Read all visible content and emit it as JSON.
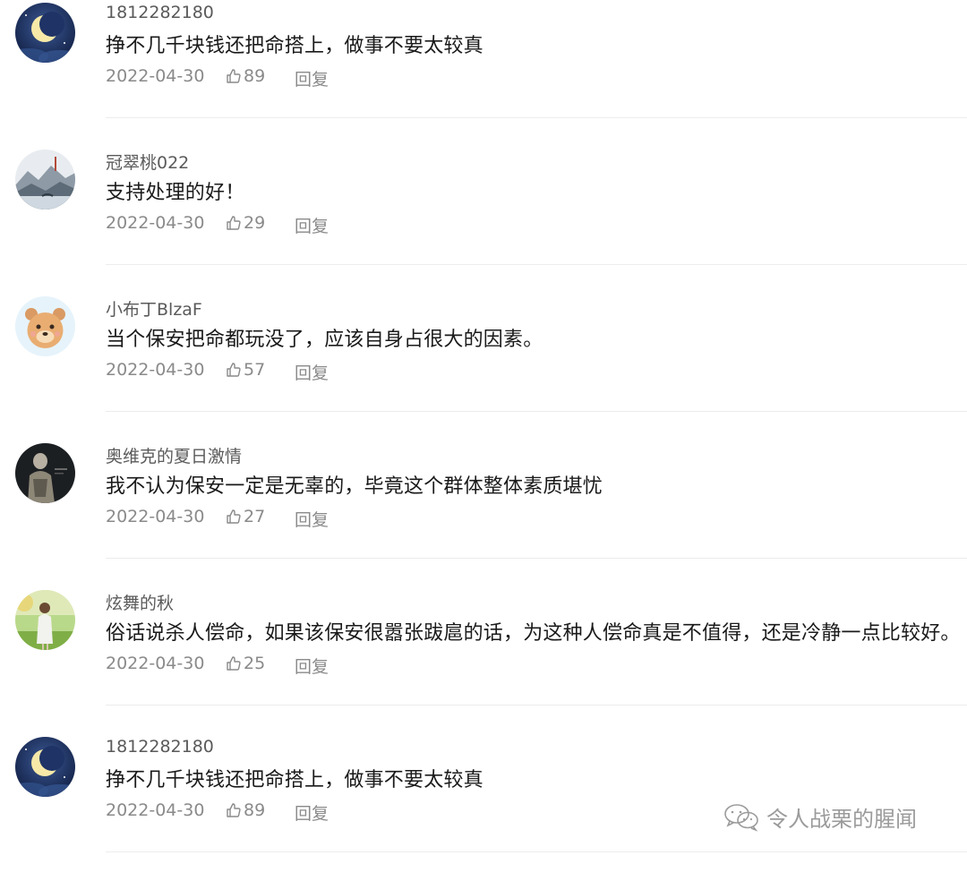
{
  "comments": [
    {
      "username": "1812282180",
      "text": "挣不几千块钱还把命搭上，做事不要太较真",
      "date": "2022-04-30",
      "likes": "89",
      "reply_label": "回复",
      "avatar_icon": "moon-night-avatar"
    },
    {
      "username": "冠翠桃022",
      "text": "支持处理的好！",
      "date": "2022-04-30",
      "likes": "29",
      "reply_label": "回复",
      "avatar_icon": "landscape-painting-avatar"
    },
    {
      "username": "小布丁BlzaF",
      "text": "当个保安把命都玩没了，应该自身占很大的因素。",
      "date": "2022-04-30",
      "likes": "57",
      "reply_label": "回复",
      "avatar_icon": "cartoon-bear-avatar"
    },
    {
      "username": "奥维克的夏日激情",
      "text": "我不认为保安一定是无辜的，毕竟这个群体整体素质堪忧",
      "date": "2022-04-30",
      "likes": "27",
      "reply_label": "回复",
      "avatar_icon": "armored-figure-avatar"
    },
    {
      "username": "炫舞的秋",
      "text": "俗话说杀人偿命，如果该保安很嚣张跋扈的话，为这种人偿命真是不值得，还是冷静一点比较好。",
      "date": "2022-04-30",
      "likes": "25",
      "reply_label": "回复",
      "avatar_icon": "person-outdoor-avatar"
    },
    {
      "username": "1812282180",
      "text": "挣不几千块钱还把命搭上，做事不要太较真",
      "date": "2022-04-30",
      "likes": "89",
      "reply_label": "回复",
      "avatar_icon": "moon-night-avatar"
    }
  ],
  "watermark": {
    "text": "令人战栗的腥闻",
    "icon": "wechat-icon"
  },
  "colors": {
    "text": "#1a1a1a",
    "username": "#5a5a5a",
    "meta": "#8a8a8a",
    "divider": "#ececec"
  }
}
